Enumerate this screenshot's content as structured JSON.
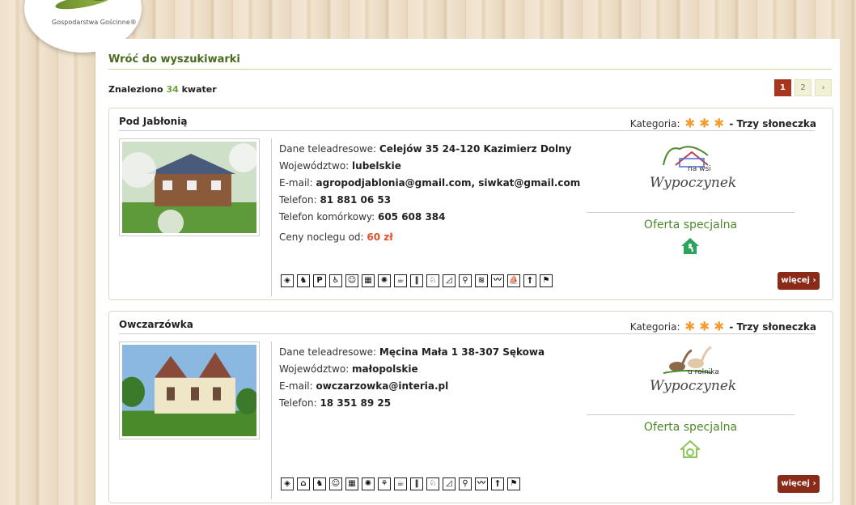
{
  "logo": {
    "text": "Gospodarstwa Gościnne®"
  },
  "back_link": "Wróć do wyszukiwarki",
  "results": {
    "prefix": "Znaleziono",
    "count": "34",
    "suffix": "kwater"
  },
  "pagination": {
    "pages": [
      "1",
      "2",
      "›"
    ],
    "active": "1"
  },
  "labels": {
    "category": "Kategoria:",
    "address": "Dane teleadresowe:",
    "voivodeship": "Województwo:",
    "email": "E-mail:",
    "phone": "Telefon:",
    "mobile": "Telefon komórkowy:",
    "price": "Ceny noclegu od:",
    "special_offer": "Oferta specjalna",
    "more": "więcej ›"
  },
  "listings": [
    {
      "name": "Pod Jabłonią",
      "category_text": "- Trzy słoneczka",
      "stars": 3,
      "address": "Celejów 35 24-120 Kazimierz Dolny",
      "voivodeship": "lubelskie",
      "email": "agropodjablonia@gmail.com, siwkat@gmail.com",
      "phone": "81 881 06 53",
      "mobile": "605 608 384",
      "price": "60 zł",
      "brand_sub": "na wsi",
      "brand_script": "Wypoczynek",
      "amenities": [
        "globe",
        "horse",
        "P",
        "wheelchair",
        "smile",
        "tables",
        "fire",
        "coffee",
        "cutlery",
        "ride",
        "hill",
        "bike",
        "pool",
        "swim",
        "boat",
        "fork",
        "run"
      ]
    },
    {
      "name": "Owczarzówka",
      "category_text": "- Trzy słoneczka",
      "stars": 3,
      "address": "Męcina Mała 1 38-307 Sękowa",
      "voivodeship": "małopolskie",
      "email": "owczarzowka@interia.pl",
      "phone": "18 351 89 25",
      "brand_sub": "u rolnika",
      "brand_script": "Wypoczynek",
      "amenities": [
        "globe",
        "playground",
        "horse",
        "smile",
        "tables",
        "fire",
        "dog",
        "coffee",
        "cutlery",
        "ride",
        "hill",
        "bike",
        "swim",
        "fork",
        "run"
      ]
    }
  ]
}
